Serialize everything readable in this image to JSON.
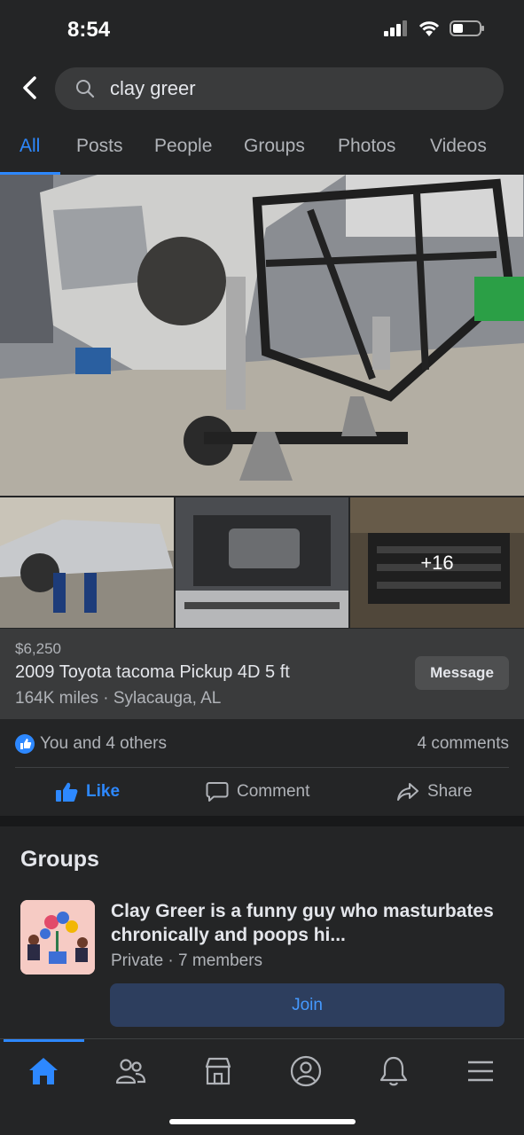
{
  "status_bar": {
    "time": "8:54"
  },
  "search": {
    "query": "clay greer"
  },
  "tabs": [
    {
      "label": "All",
      "active": true
    },
    {
      "label": "Posts"
    },
    {
      "label": "People"
    },
    {
      "label": "Groups"
    },
    {
      "label": "Photos"
    },
    {
      "label": "Videos"
    }
  ],
  "listing": {
    "more_photos": "+16",
    "price": "$6,250",
    "title": "2009 Toyota tacoma Pickup 4D 5 ft",
    "subtitle": "164K miles · Sylacauga, AL",
    "message_label": "Message"
  },
  "reactions": {
    "likes_text": "You and 4 others",
    "comments_text": "4 comments"
  },
  "actions": {
    "like": "Like",
    "comment": "Comment",
    "share": "Share"
  },
  "groups": {
    "heading": "Groups",
    "item": {
      "name": "Clay Greer is a funny guy who masturbates chronically and poops hi...",
      "meta": "Private · 7 members",
      "join_label": "Join"
    }
  },
  "colors": {
    "accent": "#2d88ff",
    "background": "#242526",
    "card": "#3a3b3c"
  }
}
